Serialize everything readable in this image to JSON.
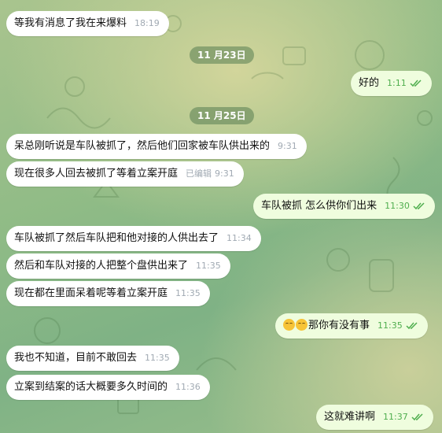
{
  "dates": [
    "11 月23日",
    "11 月25日"
  ],
  "messages": [
    {
      "dir": "in",
      "text": "等我有消息了我在来爆料",
      "time": "18:19"
    },
    {
      "dir": "out",
      "text": "好的",
      "time": "1:11"
    },
    {
      "dir": "in",
      "text": "呆总刚听说是车队被抓了，然后他们回家被车队供出来的",
      "time": "9:31"
    },
    {
      "dir": "in",
      "text": "现在很多人回去被抓了等着立案开庭",
      "edited": "已编辑",
      "time": "9:31"
    },
    {
      "dir": "out",
      "text": "车队被抓 怎么供你们出来",
      "time": "11:30"
    },
    {
      "dir": "in",
      "text": "车队被抓了然后车队把和他对接的人供出去了",
      "time": "11:34"
    },
    {
      "dir": "in",
      "text": "然后和车队对接的人把整个盘供出来了",
      "time": "11:35"
    },
    {
      "dir": "in",
      "text": "现在都在里面呆着呢等着立案开庭",
      "time": "11:35"
    },
    {
      "dir": "out",
      "emoji": [
        "grinning-sweat-emoji",
        "grinning-sweat-emoji"
      ],
      "text": "那你有没有事",
      "time": "11:35"
    },
    {
      "dir": "in",
      "text": "我也不知道，目前不敢回去",
      "time": "11:35"
    },
    {
      "dir": "in",
      "text": "立案到结案的话大概要多久时间的",
      "time": "11:36"
    },
    {
      "dir": "out",
      "text": "这就难讲啊",
      "time": "11:37"
    }
  ],
  "icons": {
    "read_receipt": "double-check-icon"
  },
  "colors": {
    "incoming_bubble": "#ffffff",
    "outgoing_bubble": "#effdde",
    "read_check": "#4fae4e"
  }
}
